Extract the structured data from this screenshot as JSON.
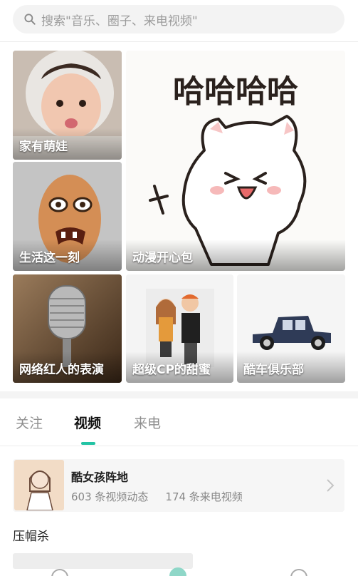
{
  "search": {
    "placeholder": "搜索\"音乐、圈子、来电视频\""
  },
  "tiles": [
    {
      "label": "家有萌娃"
    },
    {
      "label": "动漫开心包",
      "overlay_text": "哈哈哈哈"
    },
    {
      "label": "生活这一刻"
    },
    {
      "label": "网络红人的表演"
    },
    {
      "label": "超级CP的甜蜜"
    },
    {
      "label": "酷车俱乐部"
    }
  ],
  "tabs": [
    {
      "label": "关注"
    },
    {
      "label": "视频"
    },
    {
      "label": "来电"
    }
  ],
  "active_tab": "视频",
  "accent_color": "#22c3a4",
  "card": {
    "title": "酷女孩阵地",
    "video_count": "603 条视频动态",
    "call_count": "174 条来电视频"
  },
  "section": {
    "title": "压帽杀"
  }
}
